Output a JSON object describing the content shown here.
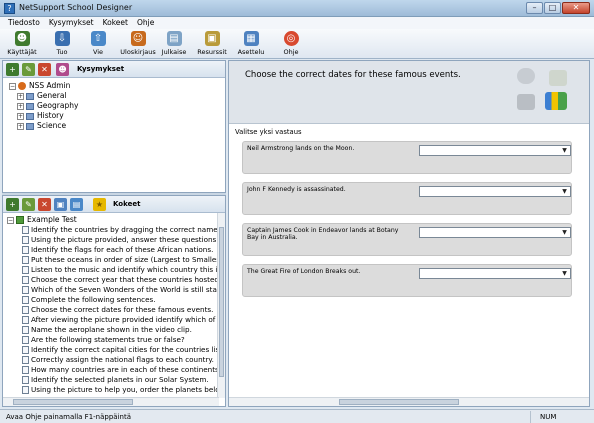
{
  "window": {
    "title": "NetSupport School Designer"
  },
  "menu": [
    "Tiedosto",
    "Kysymykset",
    "Kokeet",
    "Ohje"
  ],
  "toolbar": [
    {
      "label": "Käyttäjät",
      "icon": "users-icon",
      "color": "#3f7a2e"
    },
    {
      "label": "Tuo",
      "icon": "import-icon",
      "color": "#3a6fb0"
    },
    {
      "label": "Vie",
      "icon": "export-icon",
      "color": "#4a88c8"
    },
    {
      "label": "Uloskirjaus",
      "icon": "logout-user-icon",
      "color": "#c76a1d"
    },
    {
      "label": "Julkaise",
      "icon": "publish-icon",
      "color": "#7ea3c6"
    },
    {
      "label": "Resurssit",
      "icon": "resources-icon",
      "color": "#b99b3a"
    },
    {
      "label": "Asettelu",
      "icon": "layout-icon",
      "color": "#4f82c0"
    },
    {
      "label": "Ohje",
      "icon": "help-lifebuoy-icon",
      "color": "#d8492f"
    }
  ],
  "questions_pane": {
    "header": "Kysymykset",
    "root": "NSS Admin",
    "folders": [
      "General",
      "Geography",
      "History",
      "Science"
    ]
  },
  "tests_pane": {
    "header": "Kokeet",
    "root": "Example Test",
    "items": [
      "Identify the countries by dragging the correct name to",
      "Using the picture provided, answer these questions o",
      "Identify the flags for each of these African nations.",
      "Put these oceans in order of size (Largest to Smallest",
      "Listen to the music and identify which country this is the",
      "Choose the correct year that these countries hosted th",
      "Which of the Seven Wonders of the World is still stand",
      "Complete the following sentences.",
      "Choose the correct dates for these famous events.",
      "After viewing the picture provided identify which of the",
      "Name the aeroplane shown in the video clip.",
      "Are the following statements true or false?",
      "Identify the correct capital cities for the countries listed",
      "Correctly assign the national flags to each country.",
      "How many countries are in each of these continents?",
      "Identify the selected planets in our Solar System.",
      "Using the picture to help you, order the planets below"
    ]
  },
  "question": {
    "title": "Choose the correct dates for these famous events.",
    "instruction": "Valitse yksi vastaus",
    "answers": [
      "Neil Armstrong lands on the Moon.",
      "John F Kennedy is assassinated.",
      "Captain James Cook in Endeavor lands at Botany Bay in Australia.",
      "The Great Fire of London Breaks out."
    ]
  },
  "status": {
    "message": "Avaa Ohje painamalla F1-näppäintä",
    "num": "NUM"
  }
}
